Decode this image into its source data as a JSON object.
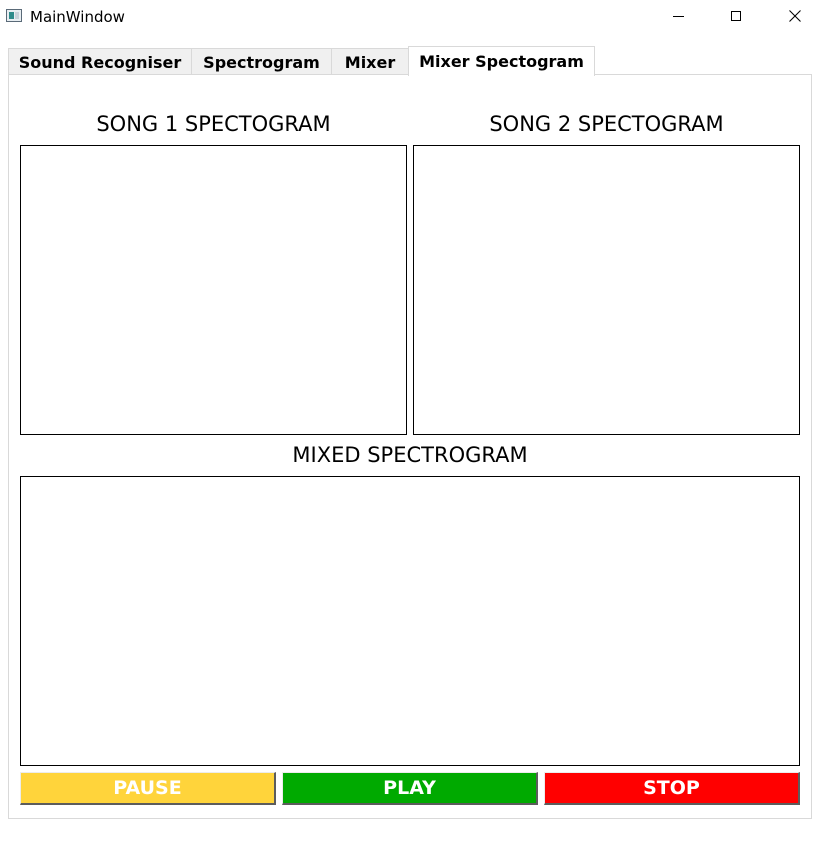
{
  "window": {
    "title": "MainWindow"
  },
  "tabs": [
    {
      "label": "Sound Recogniser",
      "active": false
    },
    {
      "label": "Spectrogram",
      "active": false
    },
    {
      "label": "Mixer",
      "active": false
    },
    {
      "label": "Mixer Spectogram",
      "active": true
    }
  ],
  "panel": {
    "song1_heading": "SONG 1 SPECTOGRAM",
    "song2_heading": "SONG 2 SPECTOGRAM",
    "mixed_heading": "MIXED SPECTROGRAM"
  },
  "controls": {
    "pause_label": "PAUSE",
    "play_label": "PLAY",
    "stop_label": "STOP"
  },
  "colors": {
    "pause": "#ffd43b",
    "play": "#00aa00",
    "stop": "#ff0000"
  }
}
